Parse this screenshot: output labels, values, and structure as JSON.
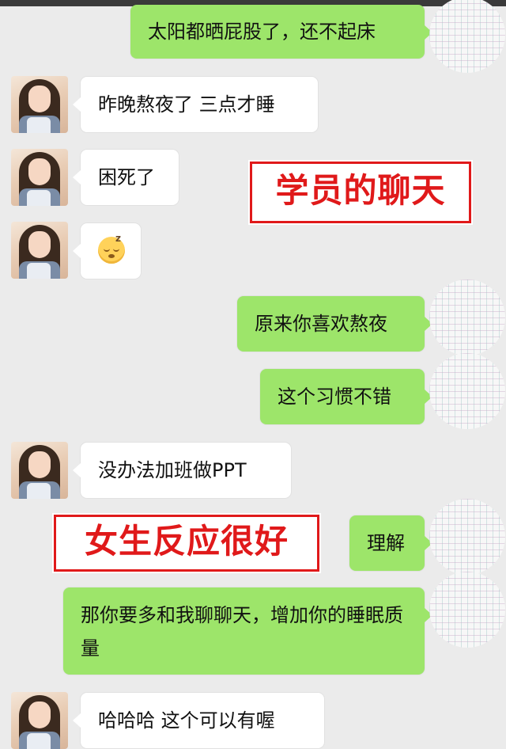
{
  "messages": [
    {
      "side": "right",
      "text": "太阳都晒屁股了，还不起床"
    },
    {
      "side": "left",
      "text": "昨晚熬夜了 三点才睡"
    },
    {
      "side": "left",
      "text": "困死了"
    },
    {
      "side": "left",
      "emoji": "sleepy-emoji"
    },
    {
      "side": "right",
      "text": "原来你喜欢熬夜"
    },
    {
      "side": "right",
      "text": "这个习惯不错"
    },
    {
      "side": "left",
      "text": "没办法加班做PPT"
    },
    {
      "side": "right",
      "text": "理解"
    },
    {
      "side": "right",
      "text": "那你要多和我聊聊天，增加你的睡眠质量"
    },
    {
      "side": "left",
      "text": "哈哈哈  这个可以有喔"
    }
  ],
  "annotations": {
    "student_chat": "学员的聊天",
    "girl_reaction": "女生反应很好"
  },
  "colors": {
    "background": "#ebebeb",
    "bubble_right": "#9de56a",
    "bubble_left": "#ffffff",
    "stamp_red": "#e0191a"
  }
}
